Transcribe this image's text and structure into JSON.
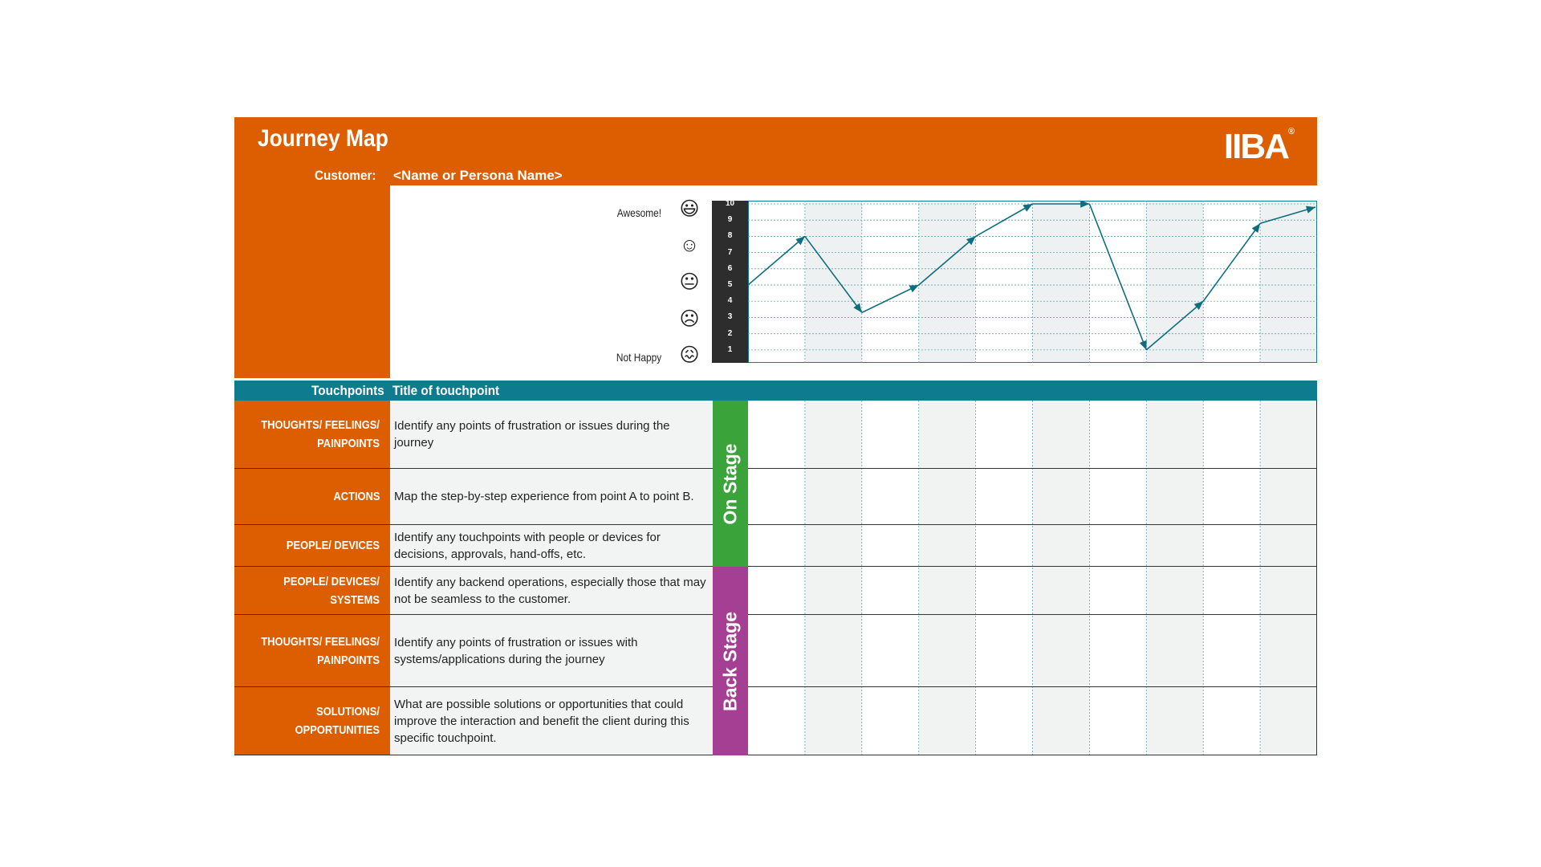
{
  "header": {
    "title": "Journey Map",
    "customer_label": "Customer:",
    "customer_value": "<Name or Persona Name>",
    "logo_text": "IIBA",
    "logo_mark": "®"
  },
  "emotion_scale": {
    "top_label": "Awesome!",
    "bottom_label": "Not Happy",
    "faces": [
      "grinning-face-icon",
      "smiling-face-icon",
      "neutral-face-icon",
      "frowning-face-icon",
      "distressed-face-icon"
    ],
    "ticks": [
      "10",
      "9",
      "8",
      "7",
      "6",
      "5",
      "4",
      "3",
      "2",
      "1"
    ]
  },
  "chart_data": {
    "type": "line",
    "x": [
      0,
      1,
      2,
      3,
      4,
      5,
      6,
      7,
      8,
      9,
      10
    ],
    "values": [
      5,
      8,
      3.3,
      5,
      8,
      10,
      10,
      1,
      4,
      8.8,
      9.8
    ],
    "ylim": [
      1,
      10
    ],
    "grid": true
  },
  "touchpoints": {
    "label": "Touchpoints",
    "title": "Title of touchpoint"
  },
  "stages": {
    "on": "On Stage",
    "back": "Back Stage"
  },
  "rows": [
    {
      "label": "THOUGHTS/ FEELINGS/ PAINPOINTS",
      "desc": "Identify any points of frustration or issues during the journey"
    },
    {
      "label": "ACTIONS",
      "desc": "Map the step-by-step experience from point A to point B."
    },
    {
      "label": "PEOPLE/ DEVICES",
      "desc": "Identify any touchpoints with people or devices for decisions, approvals, hand-offs, etc."
    },
    {
      "label": "PEOPLE/ DEVICES/ SYSTEMS",
      "desc": "Identify any backend operations, especially those that may not be seamless to the customer."
    },
    {
      "label": "THOUGHTS/ FEELINGS/ PAINPOINTS",
      "desc": "Identify any points of frustration or issues with systems/applications during the journey"
    },
    {
      "label": "SOLUTIONS/ OPPORTUNITIES",
      "desc": "What are possible solutions or opportunities that could improve the interaction and benefit the client during this specific touchpoint."
    }
  ],
  "colors": {
    "orange": "#dd5e00",
    "teal": "#0e7b8e",
    "green": "#3aa43a",
    "purple": "#a43f94"
  }
}
